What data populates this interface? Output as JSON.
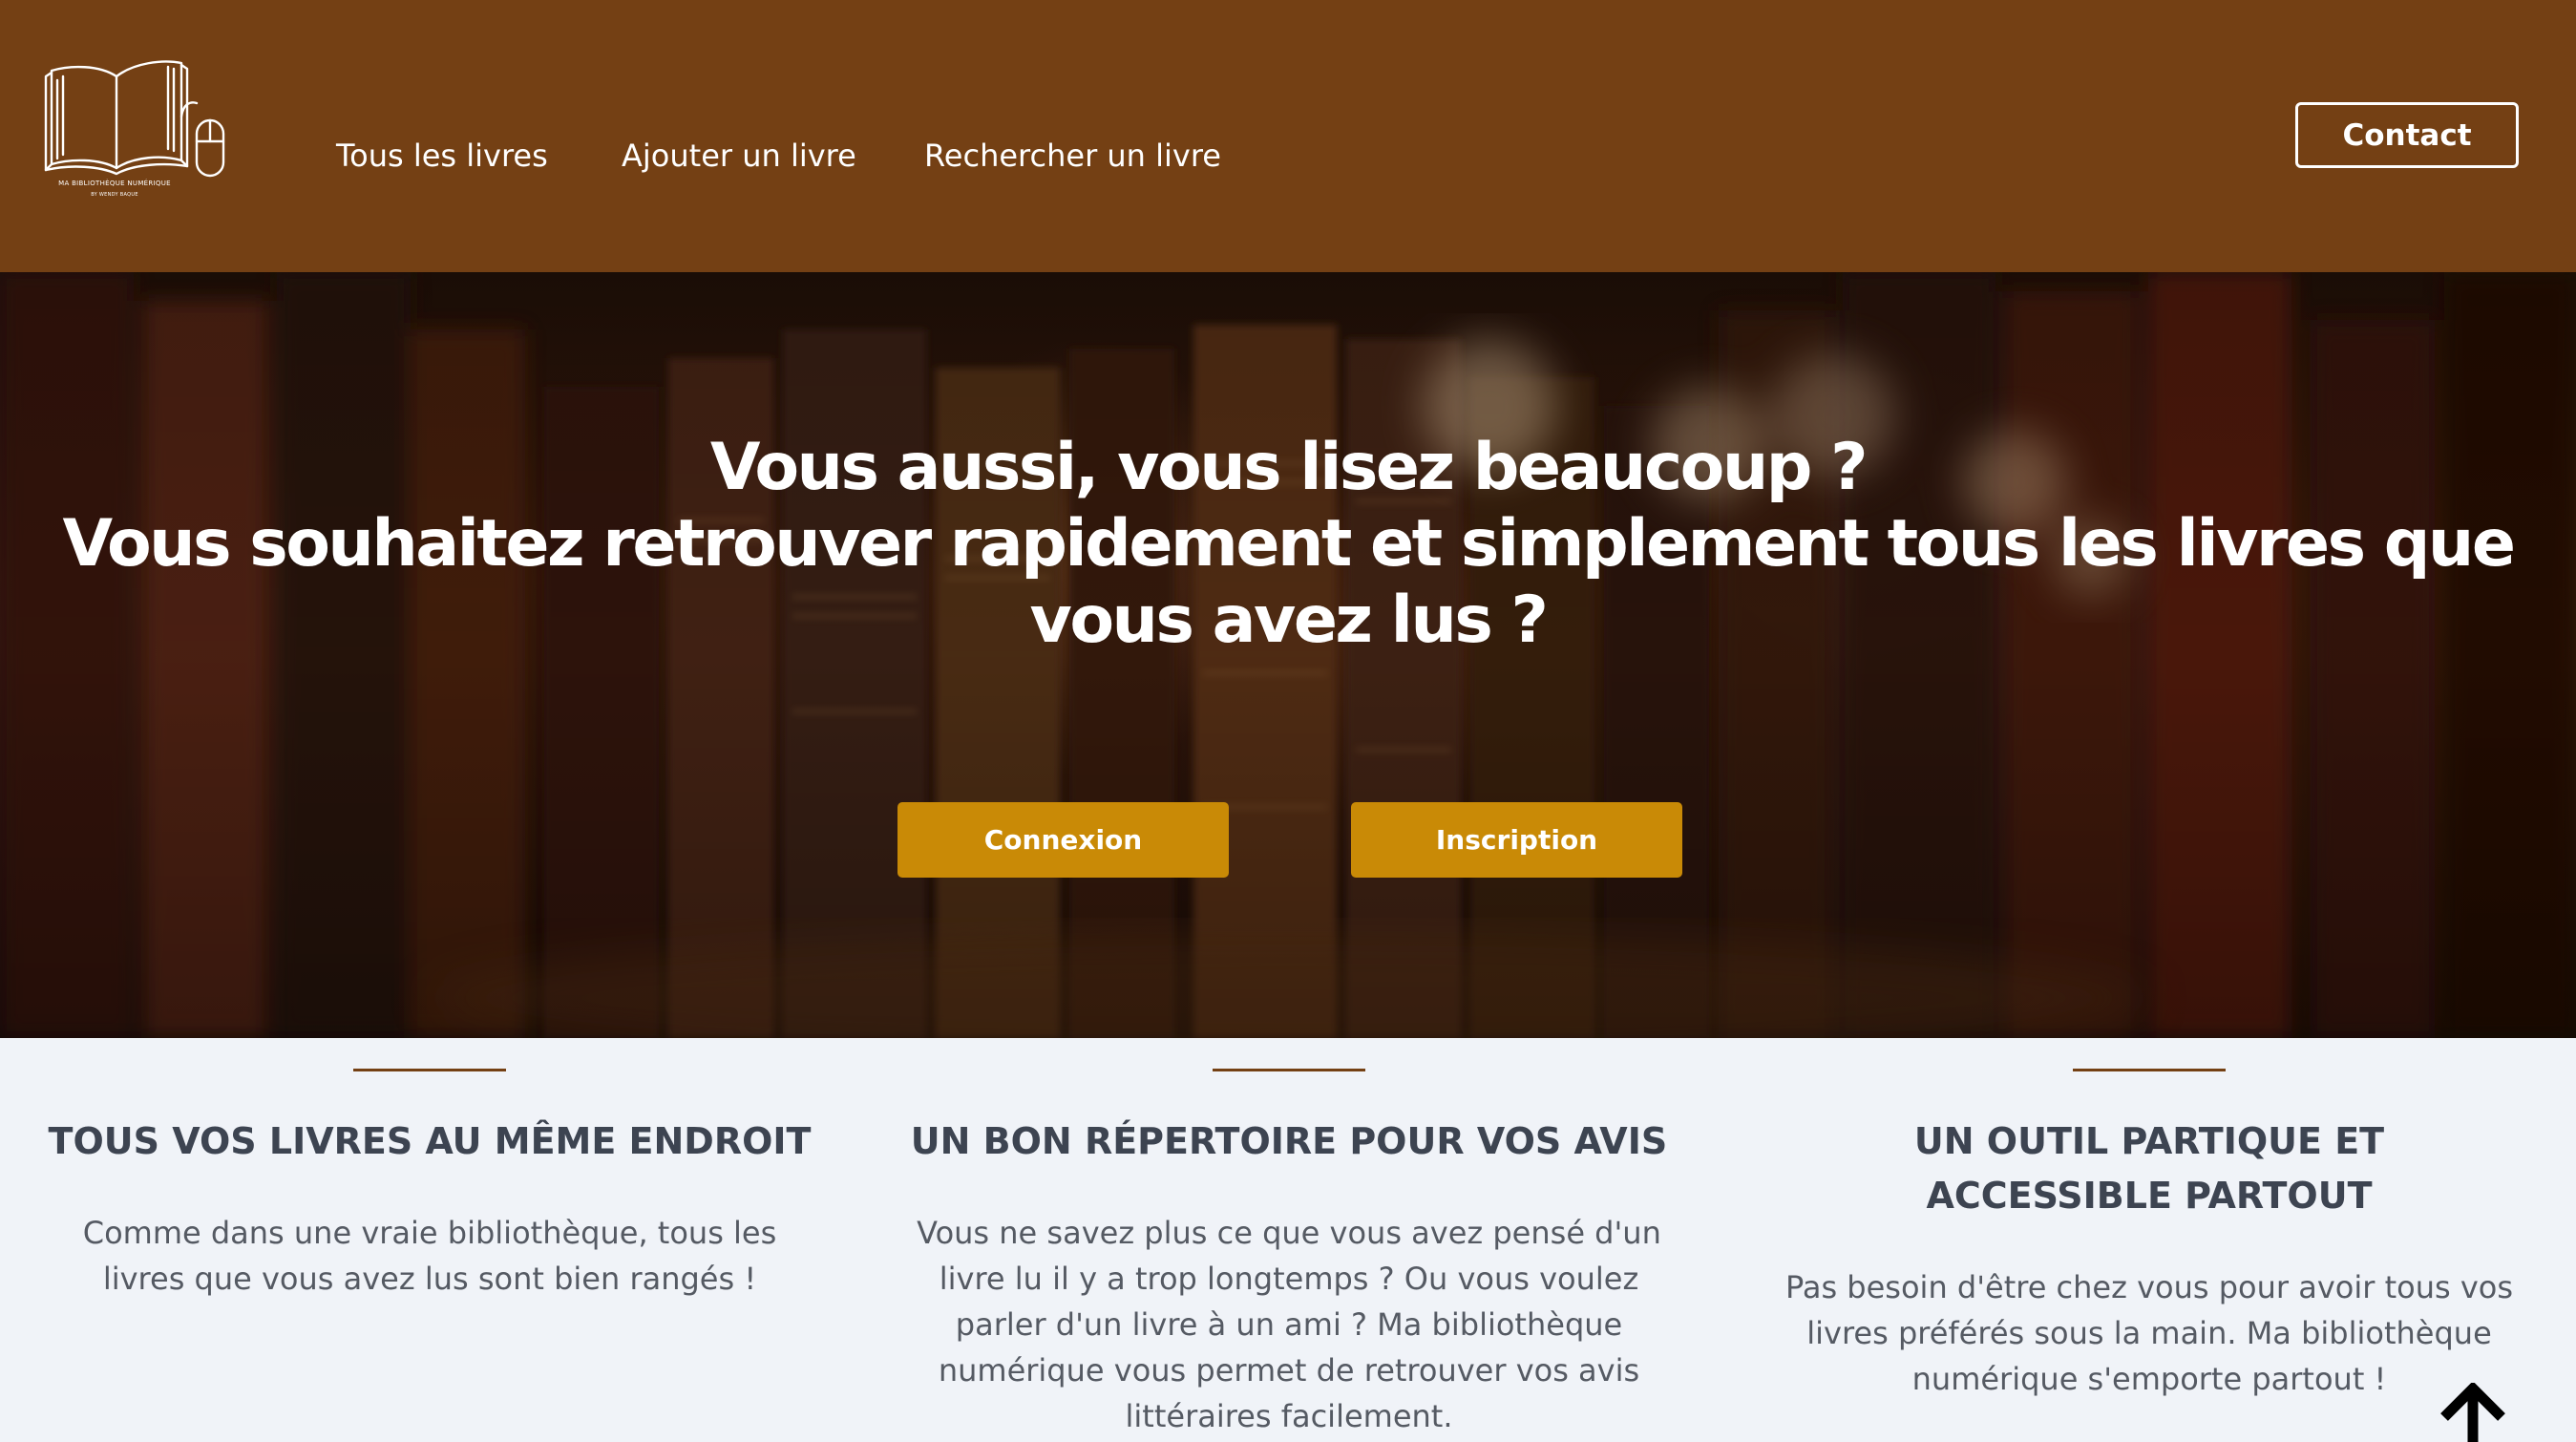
{
  "brand": {
    "logo_title": "MA BIBLIOTHÈQUE NUMÉRIQUE",
    "logo_subtitle": "BY WENDY BAQUE",
    "logo_icon": "open-book-mouse-icon"
  },
  "nav": {
    "items": [
      {
        "label": "Tous les livres"
      },
      {
        "label": "Ajouter un livre"
      },
      {
        "label": "Rechercher un livre"
      }
    ],
    "contact_label": "Contact"
  },
  "hero": {
    "line1": "Vous aussi, vous lisez beaucoup ?",
    "line2": "Vous souhaitez retrouver rapidement et simplement tous les livres que vous avez lus ?",
    "login_label": "Connexion",
    "signup_label": "Inscription"
  },
  "features": [
    {
      "title": "TOUS VOS LIVRES AU MÊME ENDROIT",
      "text": "Comme dans une vraie bibliothèque, tous les livres que vous avez lus sont bien rangés !"
    },
    {
      "title": "UN BON RÉPERTOIRE POUR VOS AVIS",
      "text": "Vous ne savez plus ce que vous avez pensé d'un livre lu il y a trop longtemps ? Ou vous voulez parler d'un livre à un ami ? Ma bibliothèque numérique vous permet de retrouver vos avis littéraires facilement."
    },
    {
      "title": "UN OUTIL PARTIQUE ET ACCESSIBLE PARTOUT",
      "text": "Pas besoin d'être chez vous pour avoir tous vos livres préférés sous la main. Ma bibliothèque numérique s'emporte partout !"
    }
  ],
  "colors": {
    "header_bg": "#744014",
    "accent_button": "#c98a06",
    "section_bg": "#f0f3f8"
  },
  "icons": {
    "scroll_top": "arrow-up-icon"
  }
}
